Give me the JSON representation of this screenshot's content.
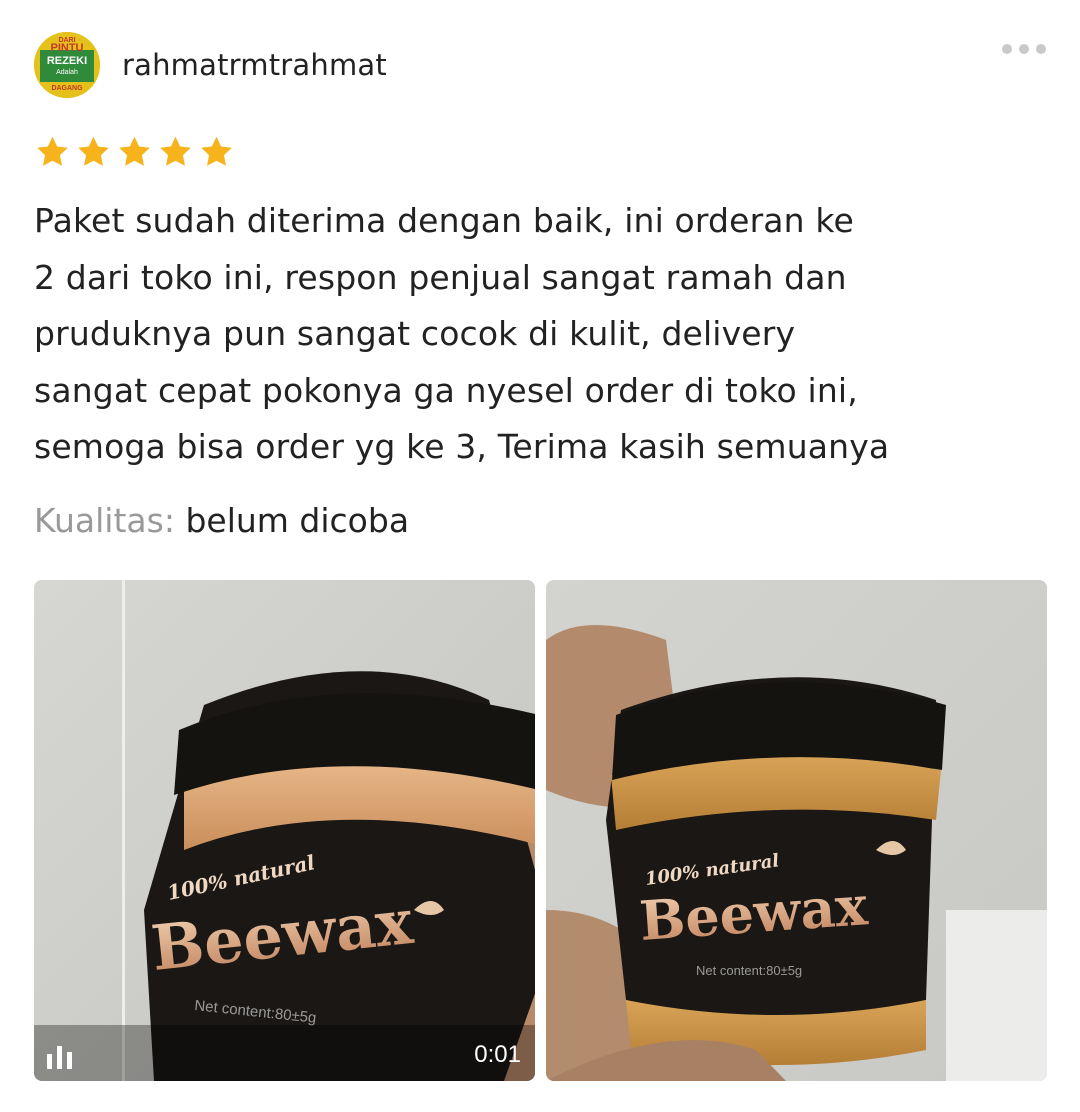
{
  "review": {
    "username": "rahmatrmtrahmat",
    "avatar_text": [
      "DARI",
      "PINTU",
      "REZEKI",
      "Adalah",
      "DAGANG"
    ],
    "rating": 5,
    "rating_max": 5,
    "star_color": "#F6B31B",
    "text_lines": [
      "Paket sudah diterima dengan baik, ini orderan ke",
      "2 dari toko ini, respon penjual sangat ramah dan",
      "pruduknya pun sangat cocok di kulit, delivery",
      "sangat cepat pokonya ga nyesel order di toko ini,",
      "semoga bisa order yg ke 3, Terima kasih semuanya"
    ],
    "quality_label": "Kualitas:",
    "quality_value": "belum dicoba"
  },
  "more_menu": {
    "icon": "more-horizontal-icon"
  },
  "media": [
    {
      "type": "video",
      "duration": "0:01",
      "product_label": {
        "tagline": "100% natural",
        "brand": "Beewax",
        "net_content": "Net content:80±5g"
      }
    },
    {
      "type": "image",
      "product_label": {
        "tagline": "100% natural",
        "brand": "Beewax",
        "net_content": "Net content:80±5g"
      }
    }
  ]
}
